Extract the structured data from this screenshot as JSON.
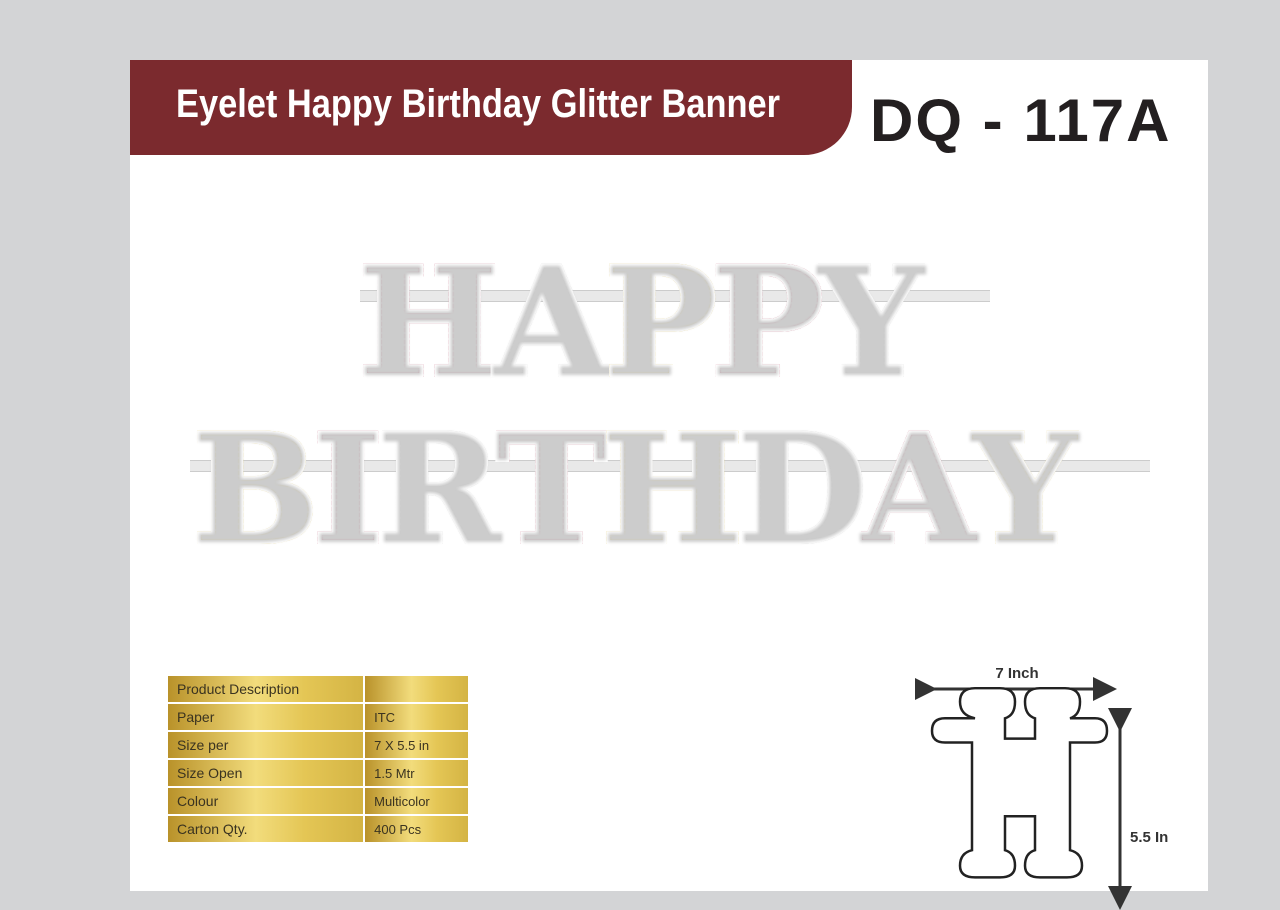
{
  "header": {
    "title": "Eyelet Happy Birthday Glitter Banner",
    "code": "DQ - 117A"
  },
  "banner": {
    "line1": [
      {
        "ch": "H",
        "color": "#b02a4c"
      },
      {
        "ch": "A",
        "color": "#bdbdbd"
      },
      {
        "ch": "P",
        "color": "#d8b93c"
      },
      {
        "ch": "P",
        "color": "#b02a4c"
      },
      {
        "ch": "Y",
        "color": "#bdbdbd"
      }
    ],
    "line2": [
      {
        "ch": "B",
        "color": "#d8b93c"
      },
      {
        "ch": "I",
        "color": "#b02a4c"
      },
      {
        "ch": "R",
        "color": "#bdbdbd"
      },
      {
        "ch": "T",
        "color": "#b02a4c"
      },
      {
        "ch": "H",
        "color": "#d8b93c"
      },
      {
        "ch": "D",
        "color": "#bdbdbd"
      },
      {
        "ch": "A",
        "color": "#b02a4c"
      },
      {
        "ch": "Y",
        "color": "#d8b93c"
      }
    ]
  },
  "specs": {
    "heading": "Product Description",
    "rows": [
      {
        "label": "Paper",
        "value": "ITC"
      },
      {
        "label": "Size per",
        "value": "7 X 5.5 in"
      },
      {
        "label": "Size Open",
        "value": "1.5 Mtr"
      },
      {
        "label": "Colour",
        "value": "Multicolor"
      },
      {
        "label": "Carton Qty.",
        "value": "400 Pcs"
      }
    ]
  },
  "dimensions": {
    "width_label": "7 Inch",
    "height_label": "5.5 In"
  }
}
